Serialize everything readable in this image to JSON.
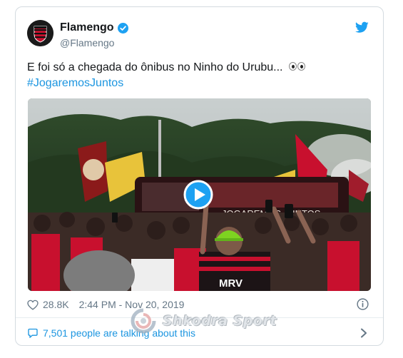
{
  "tweet": {
    "display_name": "Flamengo",
    "handle": "@Flamengo",
    "text": "E foi só a chegada do ônibus no Ninho do Urubu... ",
    "hashtag": "#JogaremosJuntos",
    "likes": "28.8K",
    "timestamp": "2:44 PM - Nov 20, 2019",
    "talking": "7,501 people are talking about this"
  },
  "media": {
    "bus_text": "JOGAREMOS JUNTOS",
    "shirt_text": "MRV"
  },
  "watermark": {
    "text": "Shkodra Sport"
  },
  "icons": {
    "verified": "verified-badge-icon",
    "brand": "twitter-bird-icon",
    "like": "heart-icon",
    "info": "info-icon",
    "reply": "chat-bubble-icon",
    "chevron": "chevron-right-icon",
    "play": "play-icon"
  },
  "colors": {
    "accent": "#1b95e0",
    "verified": "#1da1f2",
    "flamengo_red": "#c8102e"
  }
}
